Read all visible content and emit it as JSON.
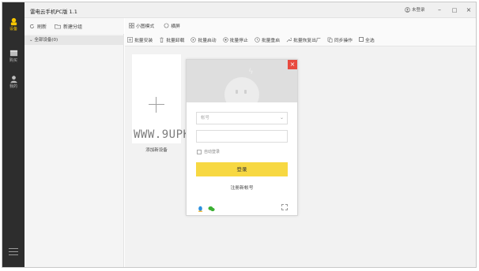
{
  "app": {
    "title": "雷电云手机PC版 1.1",
    "user_label": "未登录"
  },
  "window_controls": {
    "minimize": "–",
    "maximize": "□",
    "close": "×"
  },
  "nav": {
    "items": [
      {
        "label": "设备",
        "icon": "device-icon",
        "active": true
      },
      {
        "label": "购买",
        "icon": "shop-icon",
        "active": false
      },
      {
        "label": "我的",
        "icon": "user-icon",
        "active": false
      }
    ],
    "menu_icon": "menu-icon"
  },
  "device_list": {
    "refresh_label": "刷新",
    "new_group_label": "新建分组",
    "all_devices_label": "全部设备(0)"
  },
  "toolbar": {
    "small_view_label": "小图模式",
    "landscape_label": "横屏",
    "batch_install": "批量安装",
    "batch_uninstall": "批量卸载",
    "batch_start": "批量启动",
    "batch_stop": "批量停止",
    "batch_restart": "批量重启",
    "batch_reset": "批量恢复出厂",
    "sync_ops": "同步操作",
    "select_all": "全选"
  },
  "add_device": {
    "label": "添加新设备"
  },
  "login": {
    "account_placeholder": "帐号",
    "password_placeholder": "",
    "remember_label": "自动登录",
    "login_button": "登录",
    "register_link": "注册新帐号"
  },
  "watermark": {
    "text": "WWW.9UPK.COM"
  },
  "colors": {
    "accent": "#f7d842",
    "close_red": "#e84a3f",
    "nav_bg": "#2d2d2d"
  }
}
